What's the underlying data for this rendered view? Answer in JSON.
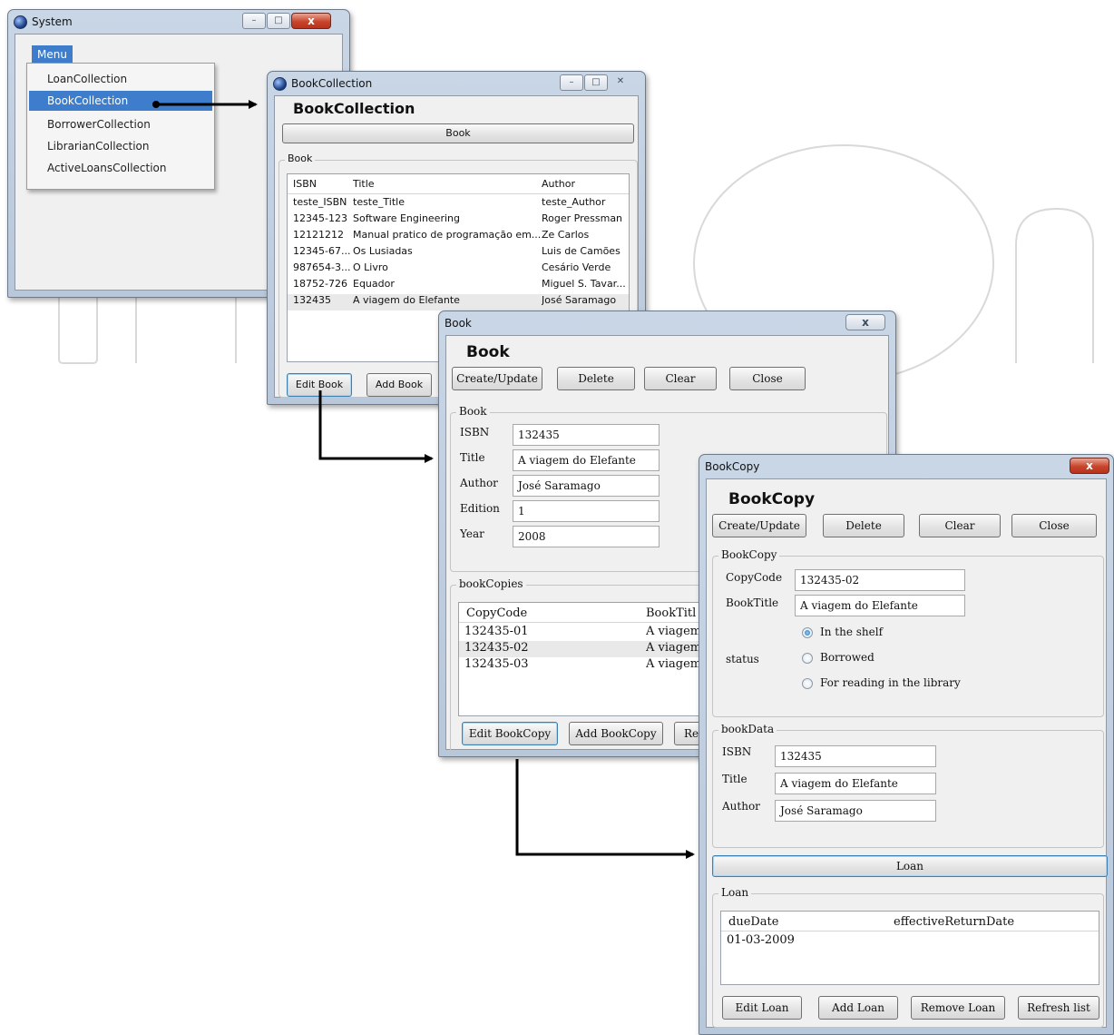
{
  "system_window": {
    "title": "System",
    "menu_label": "Menu",
    "menu_items": [
      "LoanCollection",
      "BookCollection",
      "BorrowerCollection",
      "LibrarianCollection",
      "ActiveLoansCollection"
    ]
  },
  "bookcollection_window": {
    "title": "BookCollection",
    "heading": "BookCollection",
    "book_button": "Book",
    "group_label": "Book",
    "columns": [
      "ISBN",
      "Title",
      "Author"
    ],
    "rows": [
      [
        "teste_ISBN",
        "teste_Title",
        "teste_Author"
      ],
      [
        "12345-123",
        "Software Engineering",
        "Roger Pressman"
      ],
      [
        "12121212",
        "Manual pratico de programação em...",
        "Ze Carlos"
      ],
      [
        "12345-67...",
        "Os Lusiadas",
        "Luis de Camões"
      ],
      [
        "987654-3...",
        "O Livro",
        "Cesário Verde"
      ],
      [
        "18752-726",
        "Equador",
        "Miguel S. Tavar..."
      ],
      [
        "132435",
        "A viagem do Elefante",
        "José Saramago"
      ]
    ],
    "edit_button": "Edit Book",
    "add_button": "Add Book"
  },
  "book_window": {
    "title": "Book",
    "heading": "Book",
    "buttons": [
      "Create/Update",
      "Delete",
      "Clear",
      "Close"
    ],
    "book_group": "Book",
    "fields": [
      {
        "label": "ISBN",
        "value": "132435"
      },
      {
        "label": "Title",
        "value": "A viagem do Elefante"
      },
      {
        "label": "Author",
        "value": "José Saramago"
      },
      {
        "label": "Edition",
        "value": "1"
      },
      {
        "label": "Year",
        "value": "2008"
      }
    ],
    "copies_group": "bookCopies",
    "copies_columns": [
      "CopyCode",
      "BookTitl"
    ],
    "copies_rows": [
      [
        "132435-01",
        "A viagem"
      ],
      [
        "132435-02",
        "A viagem"
      ],
      [
        "132435-03",
        "A viagem"
      ]
    ],
    "copy_buttons": [
      "Edit BookCopy",
      "Add BookCopy",
      "Re"
    ]
  },
  "bookcopy_window": {
    "title": "BookCopy",
    "heading": "BookCopy",
    "buttons": [
      "Create/Update",
      "Delete",
      "Clear",
      "Close"
    ],
    "copy_group": "BookCopy",
    "copycode_label": "CopyCode",
    "copycode_value": "132435-02",
    "booktitle_label": "BookTitle",
    "booktitle_value": "A viagem do Elefante",
    "status_label": "status",
    "status_options": [
      "In the shelf",
      "Borrowed",
      "For reading in the library"
    ],
    "status_selected": "In the shelf",
    "bookdata_group": "bookData",
    "bookdata_fields": [
      {
        "label": "ISBN",
        "value": "132435"
      },
      {
        "label": "Title",
        "value": "A viagem do Elefante"
      },
      {
        "label": "Author",
        "value": "José Saramago"
      }
    ],
    "loan_button": "Loan",
    "loan_group": "Loan",
    "loan_columns": [
      "dueDate",
      "effectiveReturnDate"
    ],
    "loan_rows": [
      [
        "01-03-2009",
        ""
      ]
    ],
    "loan_buttons": [
      "Edit Loan",
      "Add Loan",
      "Remove Loan",
      "Refresh list"
    ]
  }
}
